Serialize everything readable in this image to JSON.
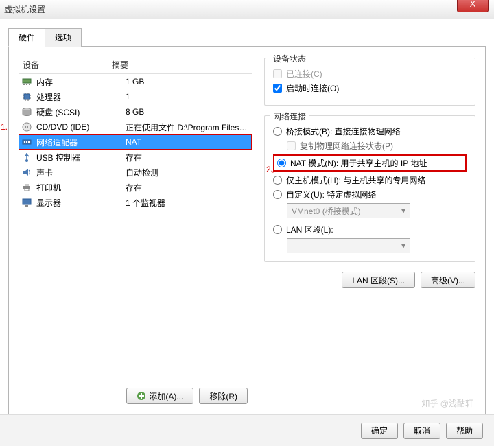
{
  "window": {
    "title": "虚拟机设置",
    "close": "X"
  },
  "tabs": {
    "hardware": "硬件",
    "options": "选项"
  },
  "columns": {
    "device": "设备",
    "summary": "摘要"
  },
  "devices": [
    {
      "icon": "memory",
      "name": "内存",
      "summary": "1 GB"
    },
    {
      "icon": "cpu",
      "name": "处理器",
      "summary": "1"
    },
    {
      "icon": "disk",
      "name": "硬盘 (SCSI)",
      "summary": "8 GB"
    },
    {
      "icon": "cd",
      "name": "CD/DVD (IDE)",
      "summary": "正在使用文件 D:\\Program Files\\VM..."
    },
    {
      "icon": "net",
      "name": "网络适配器",
      "summary": "NAT",
      "selected": true,
      "boxed": true
    },
    {
      "icon": "usb",
      "name": "USB 控制器",
      "summary": "存在"
    },
    {
      "icon": "sound",
      "name": "声卡",
      "summary": "自动检测"
    },
    {
      "icon": "printer",
      "name": "打印机",
      "summary": "存在"
    },
    {
      "icon": "display",
      "name": "显示器",
      "summary": "1 个监视器"
    }
  ],
  "left_buttons": {
    "add": "添加(A)...",
    "remove": "移除(R)"
  },
  "device_state": {
    "legend": "设备状态",
    "connected": "已连接(C)",
    "connect_on": "启动时连接(O)"
  },
  "net": {
    "legend": "网络连接",
    "bridge": "桥接模式(B): 直接连接物理网络",
    "replicate": "复制物理网络连接状态(P)",
    "nat": "NAT 模式(N): 用于共享主机的 IP 地址",
    "hostonly": "仅主机模式(H): 与主机共享的专用网络",
    "custom": "自定义(U): 特定虚拟网络",
    "vmnet": "VMnet0 (桥接模式)",
    "lan": "LAN 区段(L):"
  },
  "right_buttons": {
    "lan": "LAN 区段(S)...",
    "adv": "高级(V)..."
  },
  "dlg": {
    "ok": "确定",
    "cancel": "取消",
    "help": "帮助"
  },
  "annot": {
    "a1": "1.",
    "a2": "2、"
  },
  "watermark": "知乎 @浅酤轩"
}
